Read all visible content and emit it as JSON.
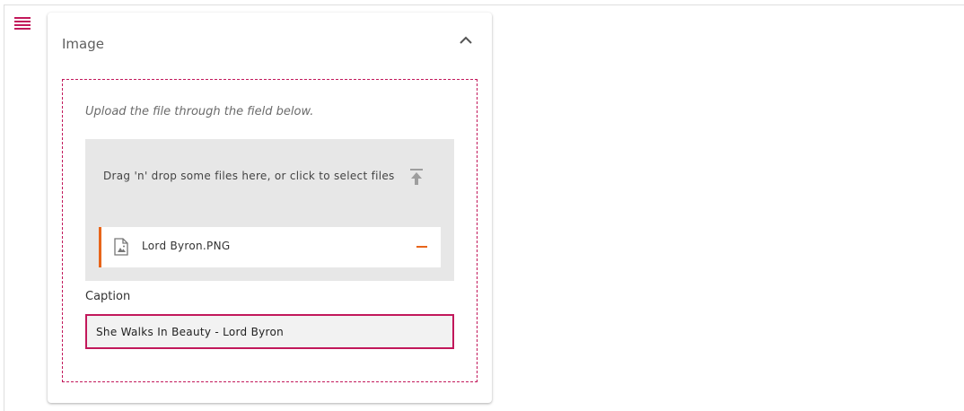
{
  "section": {
    "title": "Image",
    "collapse_icon": "chevron-up-icon",
    "drag_icon": "drag-handle-icon"
  },
  "upload": {
    "instructions": "Upload the file through the field below.",
    "dropzone_text": "Drag 'n' drop some files here, or click to select files",
    "dropzone_icon": "upload-icon",
    "files": [
      {
        "name": "Lord Byron.PNG",
        "icon": "image-file-icon",
        "remove_icon": "minus-icon"
      }
    ]
  },
  "caption": {
    "label": "Caption",
    "value": "She Walks In Beauty - Lord Byron"
  },
  "colors": {
    "accent": "#c2185b",
    "file_accent": "#e8651a",
    "dropzone_bg": "#e7e7e7"
  }
}
